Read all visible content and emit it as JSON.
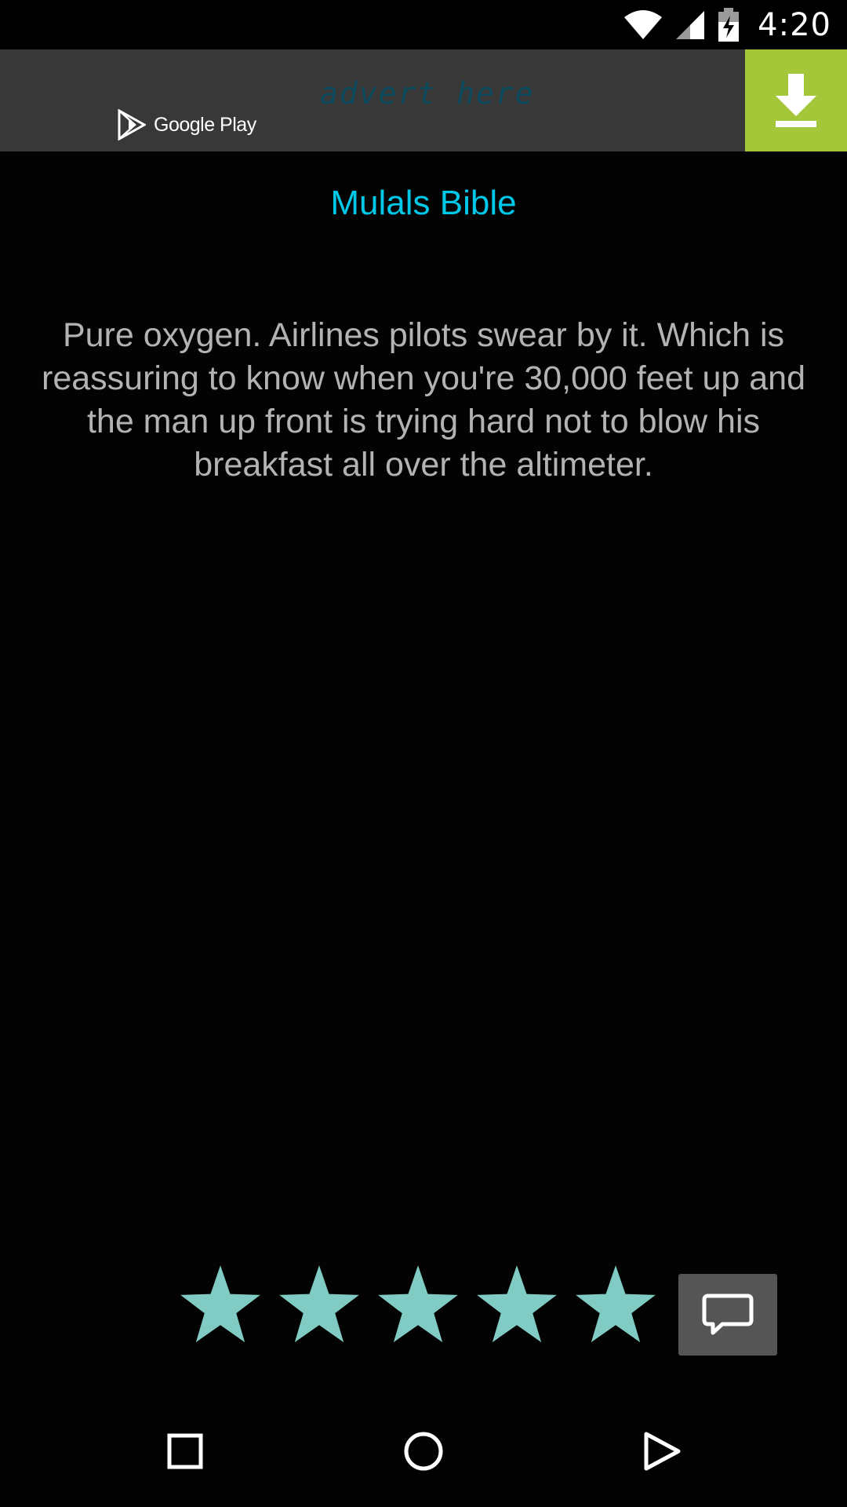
{
  "status_bar": {
    "time": "4:20",
    "icons": [
      "wifi-icon",
      "cell-signal-icon",
      "battery-charging-icon"
    ]
  },
  "ad": {
    "store_label": "Google Play",
    "advert_text": "advert here",
    "download_icon": "download-icon",
    "download_color": "#a4c639"
  },
  "content": {
    "title": "Mulals Bible",
    "quote": "Pure oxygen. Airlines pilots swear by it. Which is reassuring to know when you're 30,000 feet up and the man up front is trying hard not to blow his breakfast all over the altimeter."
  },
  "rating": {
    "stars_filled": 5,
    "stars_total": 5,
    "star_color": "#80cbc4",
    "comment_icon": "comment-icon"
  },
  "nav": {
    "icons": [
      "recents-icon",
      "home-icon",
      "back-icon"
    ]
  },
  "colors": {
    "title": "#00c8e8",
    "quote_text": "#b3b3b3",
    "background": "#030303"
  }
}
